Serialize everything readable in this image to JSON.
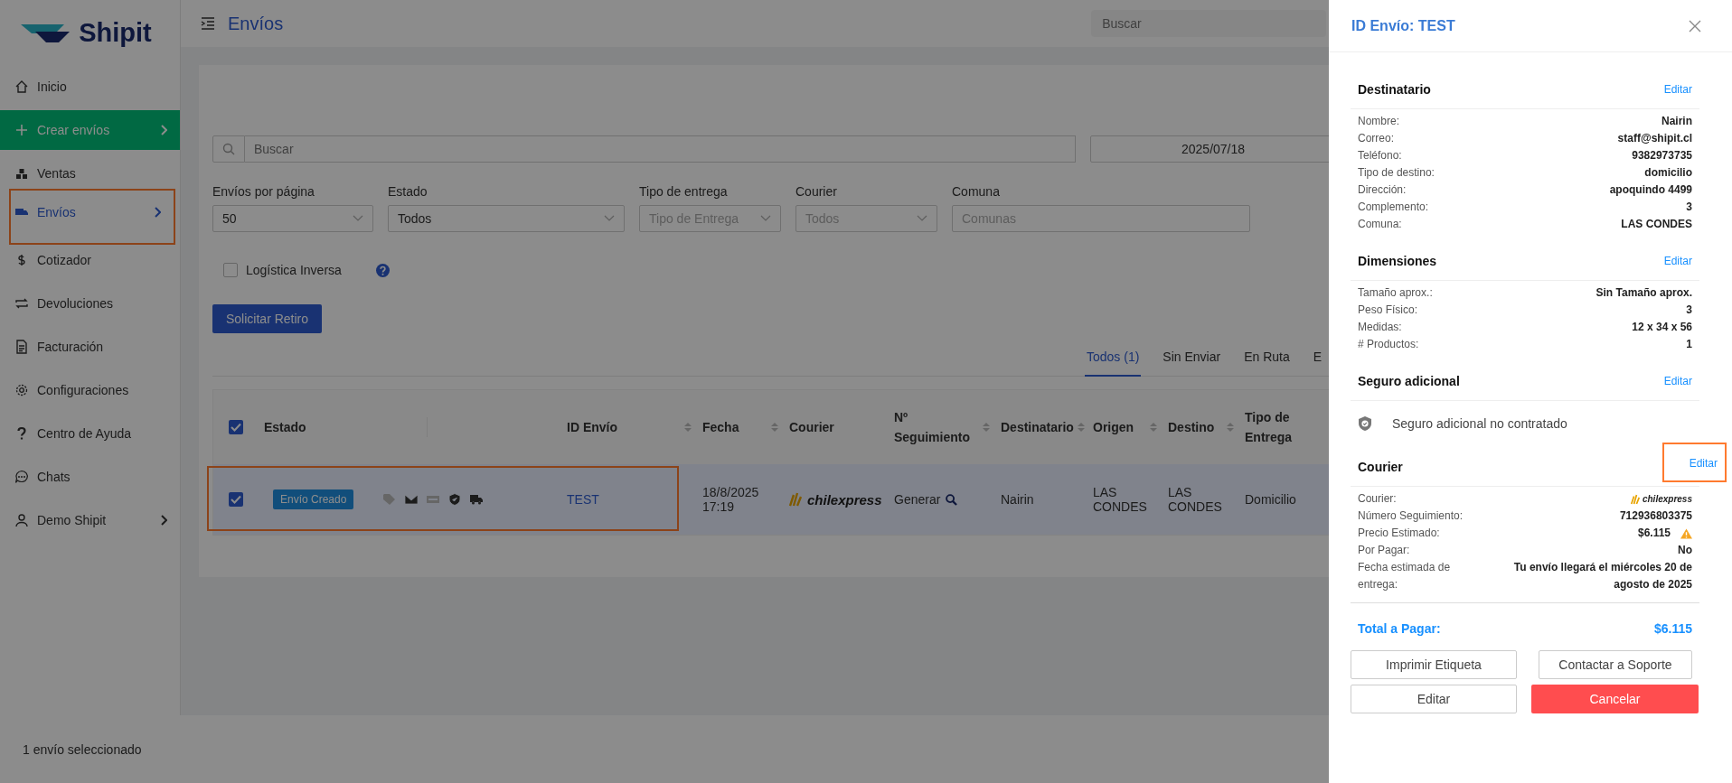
{
  "sidebar": {
    "logo": "Shipit",
    "items": [
      {
        "label": "Inicio",
        "kind": "plain",
        "submenu": false,
        "selected": false,
        "highlighted": false
      },
      {
        "label": "Crear envíos",
        "kind": "primary",
        "submenu": true,
        "selected": false,
        "highlighted": false
      },
      {
        "label": "Ventas",
        "kind": "plain",
        "submenu": false,
        "selected": false,
        "highlighted": false
      },
      {
        "label": "Envíos",
        "kind": "plain",
        "submenu": true,
        "selected": true,
        "highlighted": true
      },
      {
        "label": "Cotizador",
        "kind": "plain",
        "submenu": false,
        "selected": false,
        "highlighted": false
      },
      {
        "label": "Devoluciones",
        "kind": "plain",
        "submenu": false,
        "selected": false,
        "highlighted": false
      },
      {
        "label": "Facturación",
        "kind": "plain",
        "submenu": false,
        "selected": false,
        "highlighted": false
      },
      {
        "label": "Configuraciones",
        "kind": "plain",
        "submenu": false,
        "selected": false,
        "highlighted": false
      },
      {
        "label": "Centro de Ayuda",
        "kind": "plain",
        "submenu": false,
        "selected": false,
        "highlighted": false
      },
      {
        "label": "Chats",
        "kind": "plain",
        "submenu": false,
        "selected": false,
        "highlighted": false
      },
      {
        "label": "Demo Shipit",
        "kind": "plain",
        "submenu": true,
        "selected": false,
        "highlighted": false
      }
    ]
  },
  "header": {
    "title": "Envíos",
    "search": {
      "placeholder": "Buscar"
    }
  },
  "filters": {
    "search": {
      "placeholder": "Buscar"
    },
    "date": "2025/07/18",
    "fields": [
      {
        "label": "Envíos por página",
        "value": "50",
        "kind": "select"
      },
      {
        "label": "Estado",
        "value": "Todos",
        "kind": "select"
      },
      {
        "label": "Tipo de entrega",
        "placeholder": "Tipo de Entrega",
        "kind": "select"
      },
      {
        "label": "Courier",
        "placeholder": "Todos",
        "kind": "select"
      },
      {
        "label": "Comuna",
        "placeholder": "Comunas",
        "kind": "input"
      }
    ],
    "checkbox": {
      "label": "Logística Inversa",
      "checked": false
    },
    "button": "Solicitar Retiro"
  },
  "tabs": [
    {
      "label": "Todos (1)",
      "selected": true
    },
    {
      "label": "Sin Enviar",
      "selected": false
    },
    {
      "label": "En Ruta",
      "selected": false
    },
    {
      "label": "E",
      "selected": false
    }
  ],
  "table": {
    "all_checked": true,
    "columns": [
      {
        "label": "Estado",
        "sortable": false
      },
      {
        "label": "ID Envío",
        "sortable": true
      },
      {
        "label": "Fecha",
        "sortable": true
      },
      {
        "label": "Courier",
        "sortable": false
      },
      {
        "label": "Nº Seguimiento",
        "sortable": true
      },
      {
        "label": "Destinatario",
        "sortable": true
      },
      {
        "label": "Origen",
        "sortable": true
      },
      {
        "label": "Destino",
        "sortable": true
      },
      {
        "label": "Tipo de Entrega",
        "sortable": false
      }
    ],
    "rows": [
      {
        "checked": true,
        "highlighted": true,
        "status": "Envío Creado",
        "flags": [
          {
            "on": false
          },
          {
            "on": true
          },
          {
            "on": false
          },
          {
            "on": true
          },
          {
            "on": true
          }
        ],
        "id": "TEST",
        "fecha": "18/8/2025 17:19",
        "courier": "chilexpress",
        "tracking": "Generar",
        "destinatario": "Nairin",
        "origen": "LAS CONDES",
        "destino": "LAS CONDES",
        "tipo_entrega": "Domicilio"
      }
    ]
  },
  "status_bar": "1 envío seleccionado",
  "drawer": {
    "title": "ID Envío: TEST",
    "sections": [
      {
        "title": "Destinatario",
        "edit": "Editar",
        "edit_highlighted": false,
        "kind": "fields",
        "rows": [
          {
            "label": "Nombre:",
            "value": "Nairin",
            "kind": "text"
          },
          {
            "label": "Correo:",
            "value": "staff@shipit.cl",
            "kind": "text"
          },
          {
            "label": "Teléfono:",
            "value": "9382973735",
            "kind": "text"
          },
          {
            "label": "Tipo de destino:",
            "value": "domicilio",
            "kind": "text"
          },
          {
            "label": "Dirección:",
            "value": "apoquindo 4499",
            "kind": "text"
          },
          {
            "label": "Complemento:",
            "value": "3",
            "kind": "text"
          },
          {
            "label": "Comuna:",
            "value": "LAS CONDES",
            "kind": "text"
          }
        ]
      },
      {
        "title": "Dimensiones",
        "edit": "Editar",
        "edit_highlighted": false,
        "kind": "fields",
        "rows": [
          {
            "label": "Tamaño aprox.:",
            "value": "Sin Tamaño aprox.",
            "kind": "text"
          },
          {
            "label": "Peso Físico:",
            "value": "3",
            "kind": "text"
          },
          {
            "label": "Medidas:",
            "value": "12 x 34 x 56",
            "kind": "text"
          },
          {
            "label": "# Productos:",
            "value": "1",
            "kind": "text"
          }
        ]
      },
      {
        "title": "Seguro adicional",
        "edit": "Editar",
        "edit_highlighted": false,
        "kind": "note",
        "note": "Seguro adicional no contratado"
      },
      {
        "title": "Courier",
        "edit": "Editar",
        "edit_highlighted": true,
        "kind": "fields",
        "rows": [
          {
            "label": "Courier:",
            "value": "chilexpress",
            "kind": "logo"
          },
          {
            "label": "Número Seguimiento:",
            "value": "712936803375",
            "kind": "text"
          },
          {
            "label": "Precio Estimado:",
            "value": "$6.115",
            "kind": "warning"
          },
          {
            "label": "Por Pagar:",
            "value": "No",
            "kind": "text"
          },
          {
            "label": "Fecha estimada de entrega:",
            "value": "Tu envío llegará el miércoles 20 de agosto de 2025",
            "kind": "text"
          }
        ]
      }
    ],
    "total": {
      "label": "Total a Pagar:",
      "value": "$6.115"
    },
    "buttons": [
      {
        "label": "Imprimir Etiqueta",
        "kind": "default"
      },
      {
        "label": "Contactar a Soporte",
        "kind": "default"
      },
      {
        "label": "Editar",
        "kind": "default"
      },
      {
        "label": "Cancelar",
        "kind": "danger"
      }
    ]
  }
}
